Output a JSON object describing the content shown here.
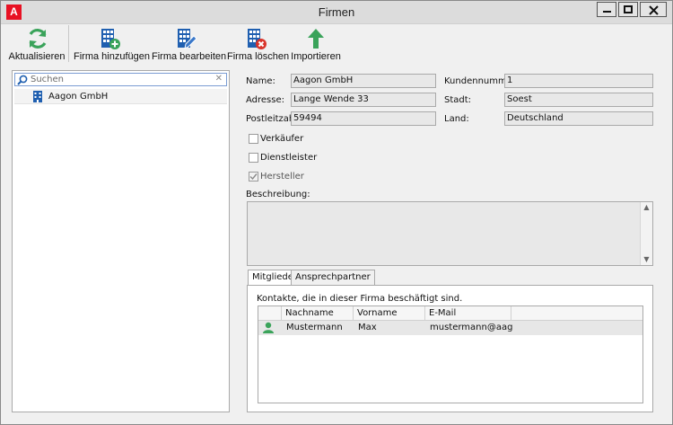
{
  "window": {
    "title": "Firmen",
    "app_icon_letter": "A"
  },
  "toolbar": {
    "refresh_label": "Aktualisieren",
    "add_label": "Firma hinzufügen",
    "edit_label": "Firma bearbeiten",
    "delete_label": "Firma löschen",
    "import_label": "Importieren"
  },
  "search": {
    "placeholder": "Suchen",
    "clear_glyph": "✕"
  },
  "company_list": [
    {
      "name": "Aagon GmbH"
    }
  ],
  "form": {
    "name_label": "Name:",
    "name_value": "Aagon GmbH",
    "customer_no_label": "Kundennummer:",
    "customer_no_value": "1",
    "address_label": "Adresse:",
    "address_value": "Lange Wende 33",
    "city_label": "Stadt:",
    "city_value": "Soest",
    "zip_label": "Postleitzahl:",
    "zip_value": "59494",
    "country_label": "Land:",
    "country_value": "Deutschland",
    "checkboxes": [
      {
        "label": "Verkäufer",
        "checked": false
      },
      {
        "label": "Dienstleister",
        "checked": false
      },
      {
        "label": "Hersteller",
        "checked": true
      }
    ],
    "description_label": "Beschreibung:",
    "description_value": ""
  },
  "tabs": [
    {
      "label": "Mitglieder",
      "active": true
    },
    {
      "label": "Ansprechpartner",
      "active": false
    }
  ],
  "members": {
    "description": "Kontakte, die in dieser Firma beschäftigt sind.",
    "columns": [
      "Nachname",
      "Vorname",
      "E-Mail"
    ],
    "rows": [
      {
        "lastname": "Mustermann",
        "firstname": "Max",
        "email": "mustermann@aago…"
      }
    ]
  },
  "colors": {
    "accent_green": "#3aa35a",
    "accent_blue": "#1f5fb0",
    "delete_red": "#d9342b",
    "app_red": "#e81123"
  },
  "icons": {
    "refresh": "refresh-icon",
    "add": "building-add-icon",
    "edit": "building-edit-icon",
    "delete": "building-delete-icon",
    "import": "arrow-up-icon",
    "search": "search-icon",
    "company": "building-icon",
    "person": "person-icon"
  }
}
